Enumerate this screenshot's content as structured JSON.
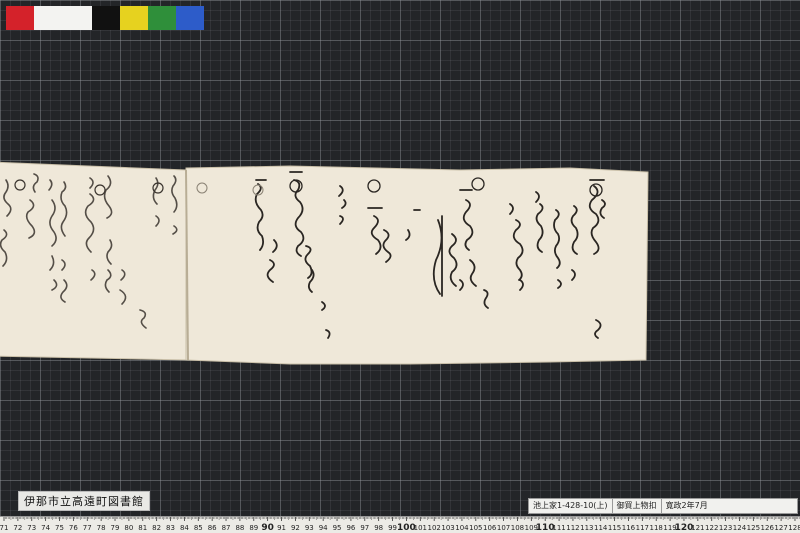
{
  "swatch_colors": [
    "#d4222a",
    "#f3f3f1",
    "#111111",
    "#e6d21f",
    "#2f8f3a",
    "#2d5cc9"
  ],
  "paper": {
    "color": "#efe8d9",
    "edge": "#c9bfa8",
    "ink": "#2a2622"
  },
  "library_label": "伊那市立高遠町図書館",
  "info_strip": {
    "catalog": "池上家1-428-10(上)",
    "title": "御買上物扣",
    "date": "寛政2年7月"
  },
  "ruler": {
    "start": 71,
    "end": 128,
    "highlight": [
      90,
      100,
      110,
      120
    ]
  }
}
